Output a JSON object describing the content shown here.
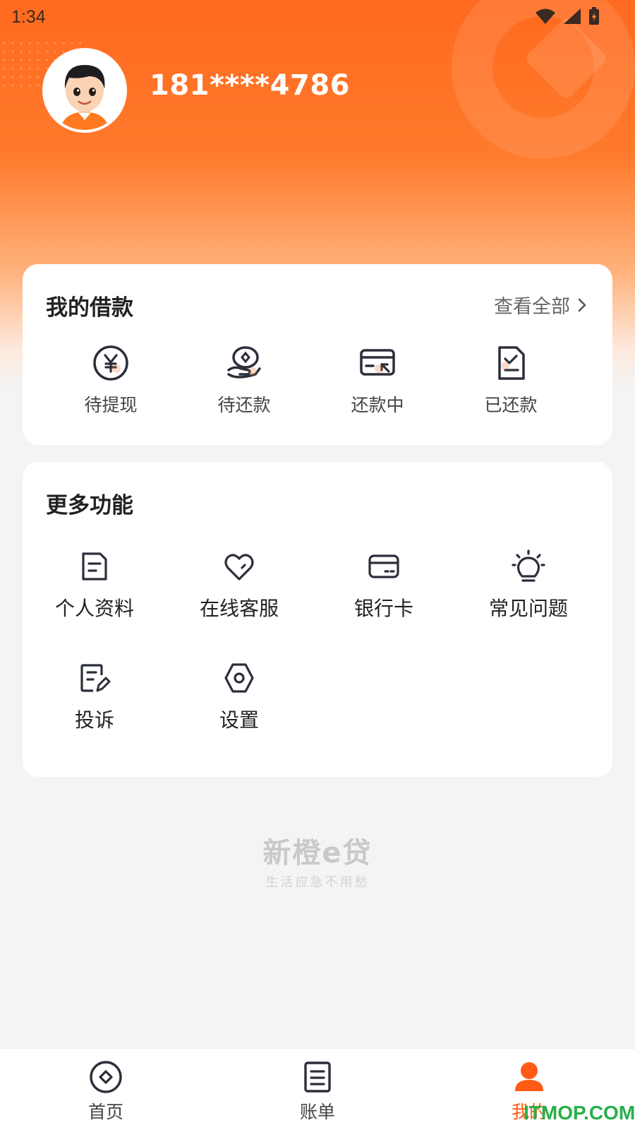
{
  "status_bar": {
    "time": "1:34"
  },
  "user": {
    "phone": "181****4786"
  },
  "loans": {
    "title": "我的借款",
    "view_all": "查看全部",
    "items": [
      {
        "label": "待提现",
        "icon": "yuan-coin-icon"
      },
      {
        "label": "待还款",
        "icon": "hand-coin-icon"
      },
      {
        "label": "还款中",
        "icon": "card-repay-icon"
      },
      {
        "label": "已还款",
        "icon": "doc-check-icon"
      }
    ]
  },
  "more": {
    "title": "更多功能",
    "items": [
      {
        "label": "个人资料",
        "icon": "profile-doc-icon"
      },
      {
        "label": "在线客服",
        "icon": "heart-service-icon"
      },
      {
        "label": "银行卡",
        "icon": "bank-card-icon"
      },
      {
        "label": "常见问题",
        "icon": "lightbulb-icon"
      },
      {
        "label": "投诉",
        "icon": "complaint-edit-icon"
      },
      {
        "label": "设置",
        "icon": "settings-icon"
      }
    ]
  },
  "watermark": {
    "logo": "新橙e贷",
    "slogan": "生活应急不用愁"
  },
  "tabbar": {
    "items": [
      {
        "label": "首页",
        "icon": "home-diamond-icon"
      },
      {
        "label": "账单",
        "icon": "bill-icon"
      },
      {
        "label": "我的",
        "icon": "user-icon"
      }
    ],
    "active_color": "#ff5b14"
  },
  "site_watermark": "ITMOP.COM",
  "colors": {
    "brand": "#ff6a1f",
    "accent": "#f26a2a"
  }
}
